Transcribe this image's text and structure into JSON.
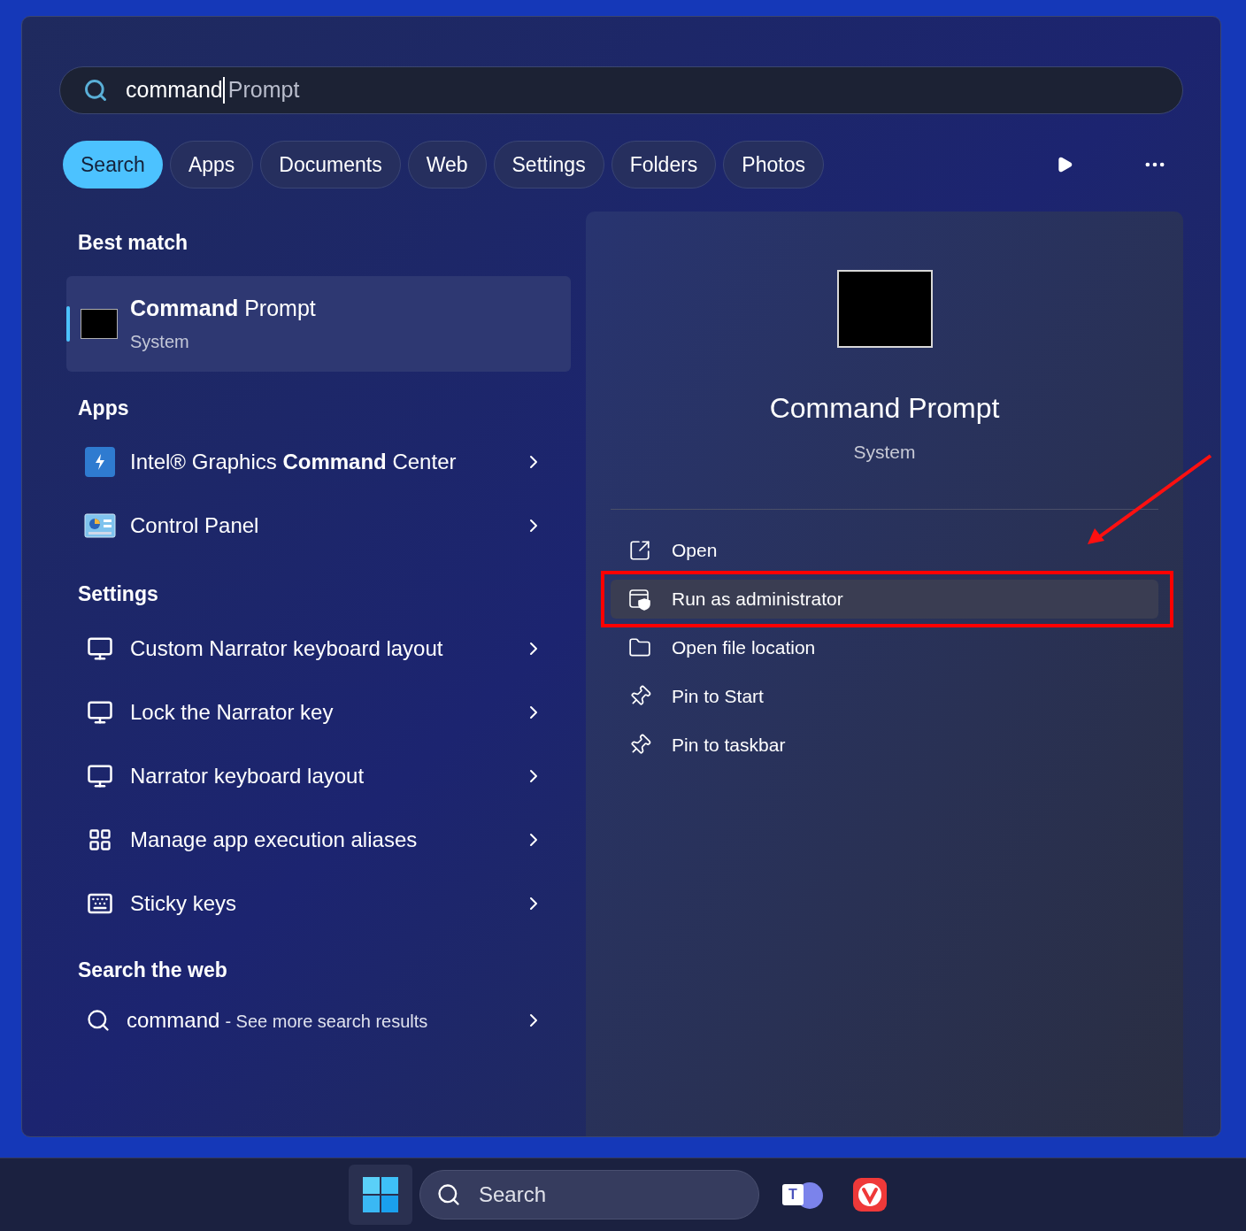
{
  "search_box": {
    "value": "command",
    "completion": "Prompt"
  },
  "filters": [
    {
      "label": "Search",
      "selected": true
    },
    {
      "label": "Apps",
      "selected": false
    },
    {
      "label": "Documents",
      "selected": false
    },
    {
      "label": "Web",
      "selected": false
    },
    {
      "label": "Settings",
      "selected": false
    },
    {
      "label": "Folders",
      "selected": false
    },
    {
      "label": "Photos",
      "selected": false
    }
  ],
  "best_match": {
    "heading": "Best match",
    "title": "**Command** Prompt",
    "subtitle": "System",
    "selected": true
  },
  "sections": [
    {
      "heading": "Apps",
      "items": [
        {
          "kind": "intel",
          "label": "Intel® Graphics **Command** Center"
        },
        {
          "kind": "control-panel",
          "label": "Control Panel"
        }
      ]
    },
    {
      "heading": "Settings",
      "items": [
        {
          "kind": "narrator",
          "label": "Custom Narrator keyboard layout"
        },
        {
          "kind": "narrator",
          "label": "Lock the Narrator key"
        },
        {
          "kind": "narrator",
          "label": "Narrator keyboard layout"
        },
        {
          "kind": "aliases",
          "label": "Manage app execution aliases"
        },
        {
          "kind": "keyboard",
          "label": "Sticky keys"
        }
      ]
    }
  ],
  "web": {
    "heading": "Search the web",
    "query": "command",
    "suffix": "- See more search results"
  },
  "details": {
    "title": "Command Prompt",
    "subtitle": "System",
    "actions": [
      {
        "kind": "open",
        "label": "Open",
        "selected": false
      },
      {
        "kind": "admin",
        "label": "Run as administrator",
        "selected": true
      },
      {
        "kind": "folder",
        "label": "Open file location",
        "selected": false
      },
      {
        "kind": "pin",
        "label": "Pin to Start",
        "selected": false
      },
      {
        "kind": "pin",
        "label": "Pin to taskbar",
        "selected": false
      }
    ]
  },
  "taskbar": {
    "search_placeholder": "Search",
    "teams_letter": "T"
  }
}
